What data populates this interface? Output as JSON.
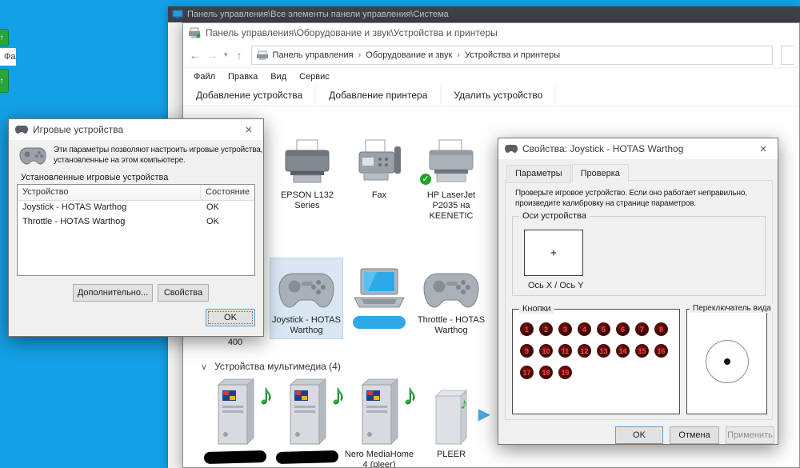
{
  "colors": {
    "desktop_bg": "#14a0e6",
    "selection": "#d9e7f5",
    "check_green": "#23a127",
    "note_green": "#2fb043",
    "button_red": "#ff4433"
  },
  "icons": {
    "back": "←",
    "forward": "→",
    "dropdown": "▾",
    "up": "↑",
    "close": "×",
    "check": "✓",
    "note": "♪",
    "play": "▶",
    "chevron": "∨",
    "crumb_sep": "›",
    "crosshair": "+"
  },
  "desktop": {
    "fragment_text": "Фа"
  },
  "win_system": {
    "title": "Панель управления\\Все элементы панели управления\\Система"
  },
  "win_devices": {
    "title": "Панель управления\\Оборудование и звук\\Устройства и принтеры",
    "breadcrumb": {
      "items": [
        "Панель управления",
        "Оборудование и звук",
        "Устройства и принтеры"
      ]
    },
    "menu": {
      "file": "Файл",
      "edit": "Правка",
      "view": "Вид",
      "service": "Сервис"
    },
    "toolbar": {
      "add_device": "Добавление устройства",
      "add_printer": "Добавление принтера",
      "remove_device": "Удалить устройство"
    },
    "devices": {
      "epson": "EPSON L132 Series",
      "fax": "Fax",
      "hp": "HP LaserJet P2035 на KEENETIC",
      "joystick": "Joystick - HOTAS Warthog",
      "throttle": "Throttle - HOTAS Warthog",
      "hidden_partial": "400"
    },
    "groups": {
      "multimedia": "Устройства мультимедиа (4)"
    },
    "multimedia": {
      "nero": "Nero MediaHome 4 (pleer)",
      "pleer": "PLEER"
    }
  },
  "game_dialog": {
    "title": "Игровые устройства",
    "description": "Эти параметры позволяют настроить игровые устройства, установленные на этом компьютере.",
    "group_label": "Установленные игровые устройства",
    "table": {
      "columns": [
        "Устройство",
        "Состояние"
      ],
      "rows": [
        {
          "device": "Joystick - HOTAS Warthog",
          "status": "OK"
        },
        {
          "device": "Throttle - HOTAS Warthog",
          "status": "OK"
        }
      ]
    },
    "buttons": {
      "advanced": "Дополнительно...",
      "properties": "Свойства",
      "ok": "OK"
    }
  },
  "props_dialog": {
    "title": "Свойства: Joystick - HOTAS Warthog",
    "tabs": {
      "settings": "Параметры",
      "test": "Проверка"
    },
    "active_tab": "Проверка",
    "description": "Проверьте игровое устройство. Если оно работает неправильно, произведите калибровку на странице параметров.",
    "axes": {
      "group": "Оси устройства",
      "label": "Ось X / Ось Y"
    },
    "buttons_group": {
      "label": "Кнопки",
      "buttons": [
        "1",
        "2",
        "3",
        "4",
        "5",
        "6",
        "7",
        "8",
        "9",
        "10",
        "11",
        "12",
        "13",
        "14",
        "15",
        "16",
        "17",
        "18",
        "19"
      ]
    },
    "pov": {
      "label": "Переключатель вида"
    },
    "footer": {
      "ok": "OK",
      "cancel": "Отмена",
      "apply": "Применить"
    }
  }
}
